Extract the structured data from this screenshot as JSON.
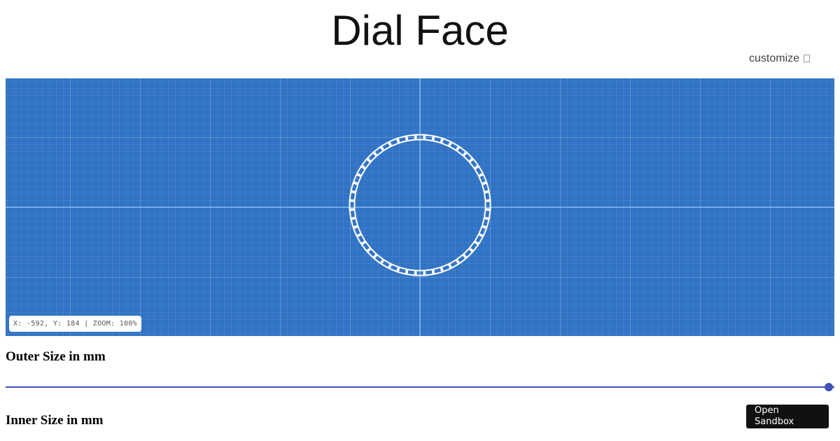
{
  "header": {
    "title": "Dial Face",
    "customize_label": "customize",
    "customize_icon": "square-icon"
  },
  "canvas": {
    "background_color": "#3173c4",
    "stroke_color": "#ffffff",
    "segment_count": 48,
    "coordinate_readout": "X: -592, Y: 184 | ZOOM: 100%"
  },
  "controls": {
    "outer_label": "Outer Size in mm",
    "inner_label": "Inner Size in mm",
    "outer_slider_fraction": 1.0,
    "accent_color": "#3f51b5"
  },
  "sandbox_button": {
    "label": "Open Sandbox"
  }
}
